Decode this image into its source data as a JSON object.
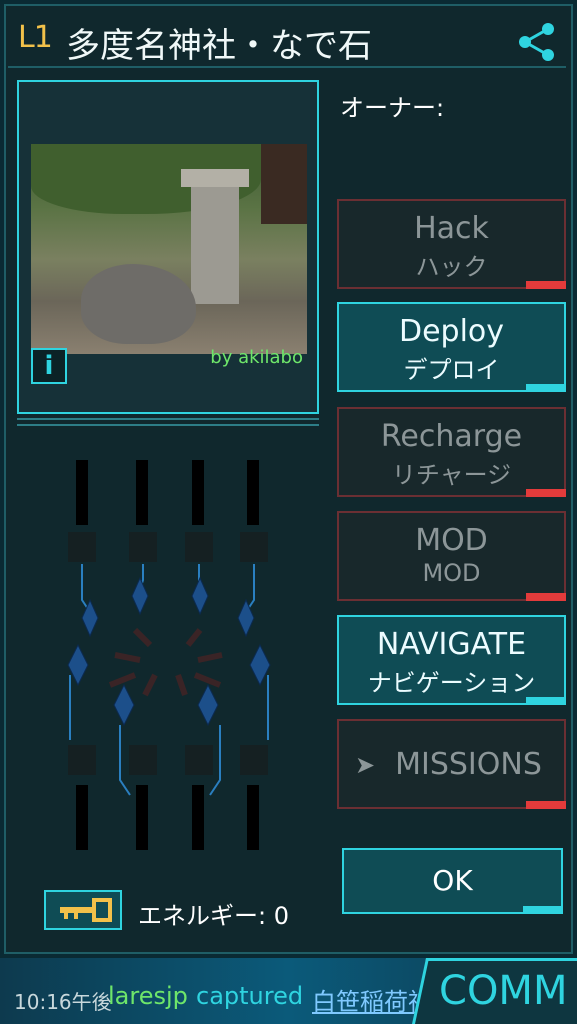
{
  "header": {
    "level": "L1",
    "portal_name": "多度名神社・なで石",
    "share_icon": "share-icon"
  },
  "photo": {
    "credit": "by akilabo",
    "info_label": "i"
  },
  "owner": {
    "label": "オーナー:"
  },
  "actions": [
    {
      "id": "hack",
      "label": "Hack",
      "sub": "ハック",
      "enabled": false
    },
    {
      "id": "deploy",
      "label": "Deploy",
      "sub": "デプロイ",
      "enabled": true
    },
    {
      "id": "recharge",
      "label": "Recharge",
      "sub": "リチャージ",
      "enabled": false
    },
    {
      "id": "mod",
      "label": "MOD",
      "sub": "MOD",
      "enabled": false
    },
    {
      "id": "navigate",
      "label": "NAVIGATE",
      "sub": "ナビゲーション",
      "enabled": true
    },
    {
      "id": "missions",
      "label": "MISSIONS",
      "sub": "",
      "enabled": false
    }
  ],
  "ok_label": "OK",
  "energy": {
    "label": "エネルギー: 0"
  },
  "comm": {
    "time": "10:16午後",
    "agent": "laresjp",
    "action": "captured",
    "portal": "白笹稲荷神",
    "button_label": "COMM"
  },
  "colors": {
    "accent": "#2fd4e0",
    "disabled_border": "#6b2f33",
    "disabled_corner": "#e23b3b",
    "level": "#f2c14a",
    "agent_green": "#6ee66a"
  }
}
